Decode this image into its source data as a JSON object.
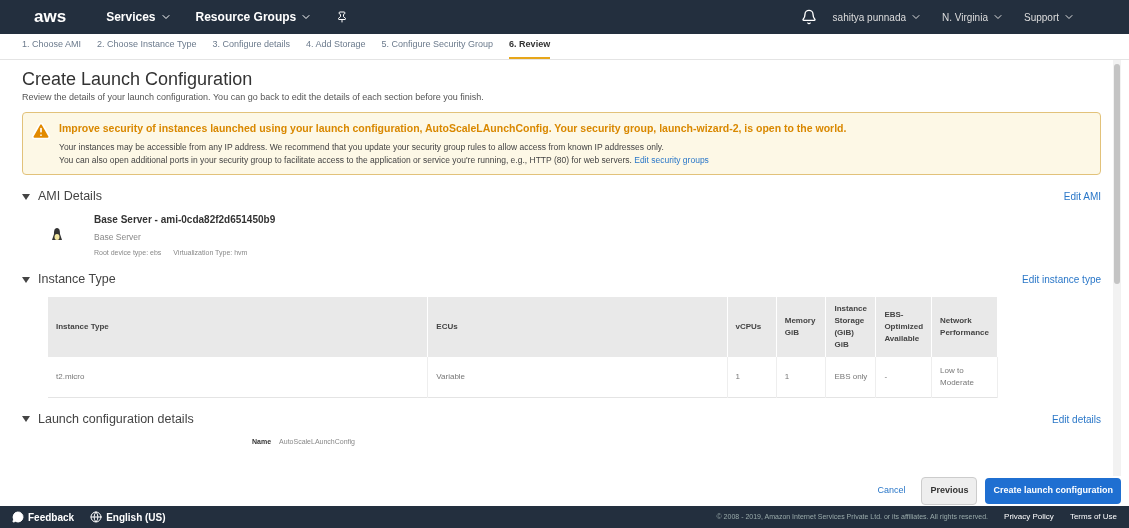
{
  "nav": {
    "logo": "aws",
    "menus": [
      {
        "label": "Services",
        "caret": true
      },
      {
        "label": "Resource Groups",
        "caret": true
      }
    ],
    "right": [
      {
        "label": "sahitya punnada",
        "caret": true
      },
      {
        "label": "N. Virginia",
        "caret": true
      },
      {
        "label": "Support",
        "caret": true
      }
    ]
  },
  "steps": [
    {
      "label": "1. Choose AMI",
      "selected": false
    },
    {
      "label": "2. Choose Instance Type",
      "selected": false
    },
    {
      "label": "3. Configure details",
      "selected": false
    },
    {
      "label": "4. Add Storage",
      "selected": false
    },
    {
      "label": "5. Configure Security Group",
      "selected": false
    },
    {
      "label": "6. Review",
      "selected": true
    }
  ],
  "page": {
    "title": "Create Launch Configuration",
    "subtitle": "Review the details of your launch configuration. You can go back to edit the details of each section before you finish."
  },
  "warning": {
    "title": "Improve security of instances launched using your launch configuration, AutoScaleLAunchConfig. Your security group, launch-wizard-2, is open to the world.",
    "line_1": "Your instances may be accessible from any IP address. We recommend that you update your security group rules to allow access from known IP addresses only.",
    "line_2": "You can also open additional ports in your security group to facilitate access to the application or service you're running, e.g., HTTP (80) for web servers.",
    "link": "Edit security groups"
  },
  "sections": [
    {
      "kind": "ami",
      "title": "AMI Details",
      "expanded": true,
      "edit": "Edit AMI",
      "ami_name": "Base Server - ami-0cda82f2d651450b9",
      "ami_desc": "Base Server",
      "root_device": "Root device type: ebs",
      "virtualization": "Virtualization Type: hvm"
    },
    {
      "kind": "table",
      "title": "Instance Type",
      "expanded": true,
      "edit": "Edit instance type",
      "columns": [
        "Instance Type",
        "ECUs",
        "vCPUs",
        "Memory GiB",
        "Instance Storage (GiB) GiB",
        "EBS-Optimized Available",
        "Network Performance"
      ],
      "rows": [
        [
          "t2.micro",
          "Variable",
          "1",
          "1",
          "EBS only",
          "-",
          "Low to Moderate"
        ]
      ]
    },
    {
      "kind": "fields",
      "title": "Launch configuration details",
      "expanded": true,
      "edit": "Edit details",
      "fields": [
        {
          "label": "Name",
          "value": "AutoScaleLAunchConfig"
        }
      ]
    }
  ],
  "actions": {
    "cancel": "Cancel",
    "previous": "Previous",
    "create": "Create launch configuration"
  },
  "footer": {
    "feedback": "Feedback",
    "language": "English (US)",
    "copyright": "© 2008 - 2019, Amazon Internet Services Private Ltd. or its affiliates. All rights reserved.",
    "links": [
      "Privacy Policy",
      "Terms of Use"
    ]
  }
}
